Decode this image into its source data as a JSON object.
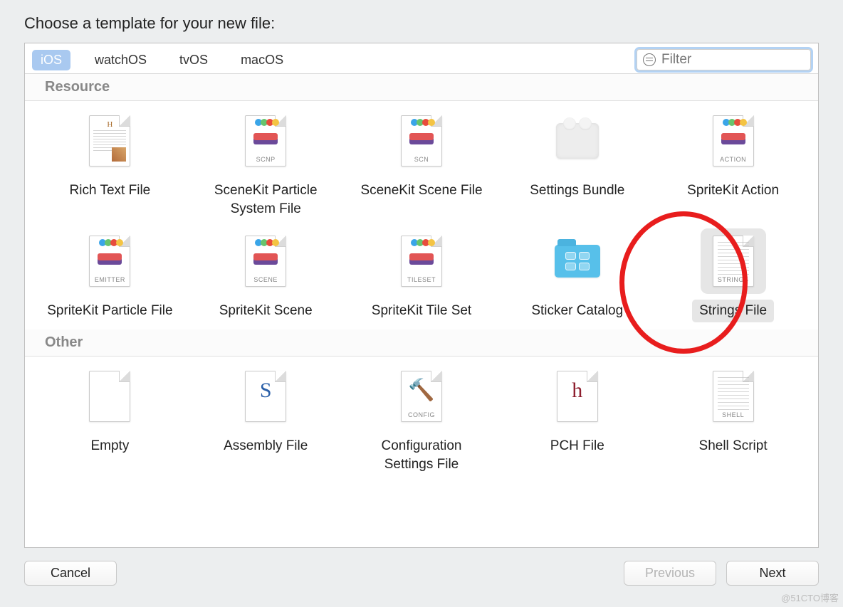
{
  "title": "Choose a template for your new file:",
  "tabs": [
    "iOS",
    "watchOS",
    "tvOS",
    "macOS"
  ],
  "active_tab": 0,
  "filter_placeholder": "Filter",
  "sections": [
    {
      "name": "Resource",
      "items": [
        {
          "label": "Rich Text File",
          "icon": "rtf"
        },
        {
          "label": "SceneKit Particle System File",
          "icon": "sk",
          "tag": "SCNP"
        },
        {
          "label": "SceneKit Scene File",
          "icon": "sk",
          "tag": "SCN"
        },
        {
          "label": "Settings Bundle",
          "icon": "bundle"
        },
        {
          "label": "SpriteKit Action",
          "icon": "sk",
          "tag": "ACTION"
        },
        {
          "label": "SpriteKit Particle File",
          "icon": "sk",
          "tag": "EMITTER"
        },
        {
          "label": "SpriteKit Scene",
          "icon": "sk",
          "tag": "SCENE"
        },
        {
          "label": "SpriteKit Tile Set",
          "icon": "sk",
          "tag": "TILESET"
        },
        {
          "label": "Sticker Catalog",
          "icon": "folder"
        },
        {
          "label": "Strings File",
          "icon": "strings",
          "tag": "STRINGS",
          "selected": true
        }
      ]
    },
    {
      "name": "Other",
      "items": [
        {
          "label": "Empty",
          "icon": "blank"
        },
        {
          "label": "Assembly File",
          "icon": "glyph",
          "glyph": "S",
          "glyph_color": "#2a5fa8",
          "glyph_font": "Georgia, serif"
        },
        {
          "label": "Configuration Settings File",
          "icon": "glyph",
          "glyph": "🔨",
          "tag": "CONFIG"
        },
        {
          "label": "PCH File",
          "icon": "glyph",
          "glyph": "h",
          "glyph_color": "#8e1f2f",
          "glyph_font": "Georgia, serif"
        },
        {
          "label": "Shell Script",
          "icon": "textlines",
          "tag": "SHELL"
        }
      ]
    }
  ],
  "buttons": {
    "cancel": "Cancel",
    "previous": "Previous",
    "next": "Next"
  },
  "highlight_item": "Strings File",
  "watermark": "@51CTO博客"
}
